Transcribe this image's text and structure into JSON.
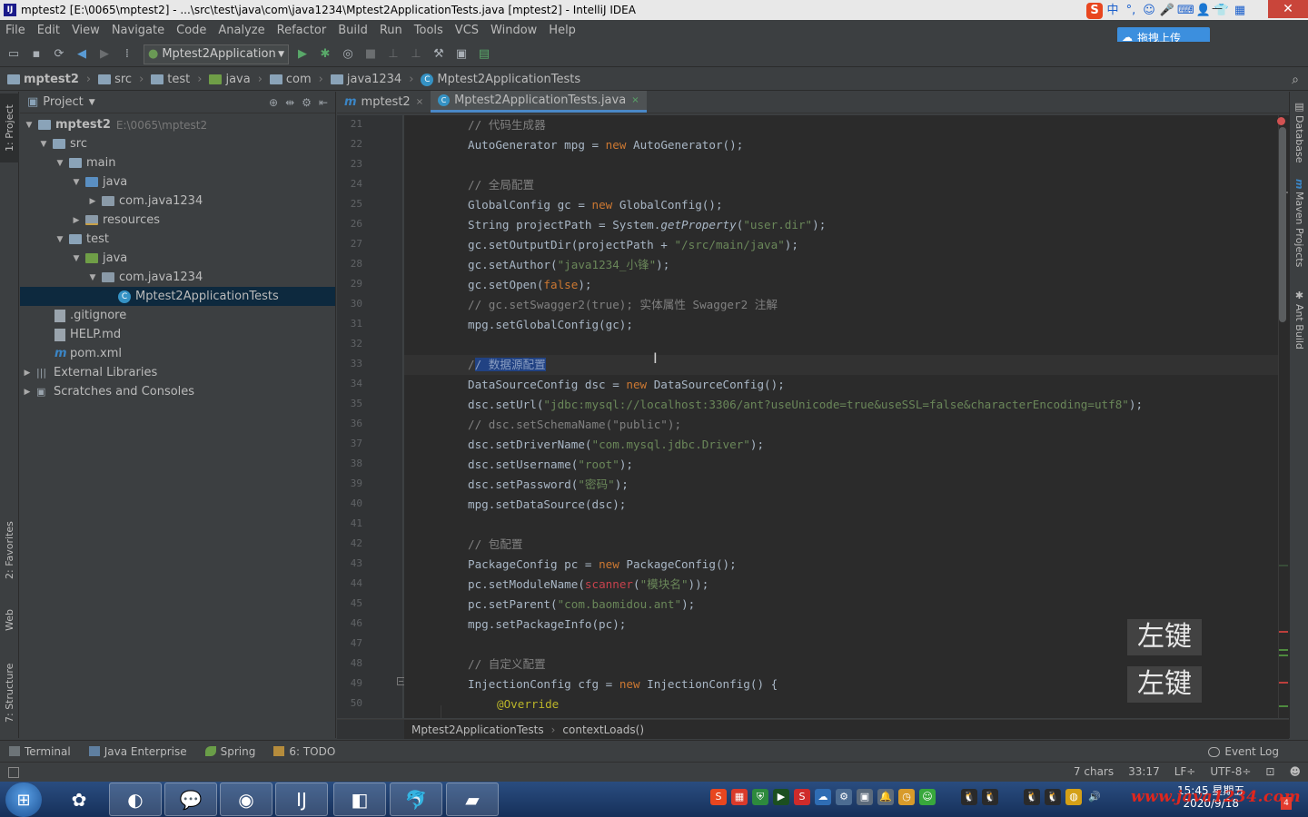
{
  "window": {
    "title": "mptest2 [E:\\0065\\mptest2] - ...\\src\\test\\java\\com\\java1234\\Mptest2ApplicationTests.java [mptest2] - IntelliJ IDEA",
    "app_icon_label": "IJ",
    "minimize": "—",
    "close": "✕"
  },
  "ime": {
    "sogou": "S",
    "items": [
      "中",
      "°,",
      "☺",
      "🎤",
      "⌨",
      "👤",
      "👕",
      "▦"
    ]
  },
  "upload_label": "拖拽上传",
  "menu": [
    "File",
    "Edit",
    "View",
    "Navigate",
    "Code",
    "Analyze",
    "Refactor",
    "Build",
    "Run",
    "Tools",
    "VCS",
    "Window",
    "Help"
  ],
  "toolbar": {
    "run_config": "Mptest2Application"
  },
  "breadcrumbs": [
    "mptest2",
    "src",
    "test",
    "java",
    "com",
    "java1234",
    "Mptest2ApplicationTests"
  ],
  "left_stripe": {
    "project": "1: Project",
    "favorites": "2: Favorites",
    "web": "Web",
    "structure": "7: Structure"
  },
  "project_panel": {
    "title": "Project",
    "tree": [
      {
        "label": "mptest2",
        "path": "E:\\0065\\mptest2"
      },
      {
        "label": "src"
      },
      {
        "label": "main"
      },
      {
        "label": "java"
      },
      {
        "label": "com.java1234"
      },
      {
        "label": "resources"
      },
      {
        "label": "test"
      },
      {
        "label": "java"
      },
      {
        "label": "com.java1234"
      },
      {
        "label": "Mptest2ApplicationTests"
      },
      {
        "label": ".gitignore"
      },
      {
        "label": "HELP.md"
      },
      {
        "label": "pom.xml"
      },
      {
        "label": "External Libraries"
      },
      {
        "label": "Scratches and Consoles"
      }
    ]
  },
  "tabs": [
    {
      "label": "mptest2",
      "close": "×"
    },
    {
      "label": "Mptest2ApplicationTests.java",
      "close": "×"
    }
  ],
  "editor": {
    "first_line": 21,
    "line_numbers": [
      "21",
      "22",
      "23",
      "24",
      "25",
      "26",
      "27",
      "28",
      "29",
      "30",
      "31",
      "32",
      "33",
      "34",
      "35",
      "36",
      "37",
      "38",
      "39",
      "40",
      "41",
      "42",
      "43",
      "44",
      "45",
      "46",
      "47",
      "48",
      "49",
      "50"
    ],
    "lines": [
      "// 代码生成器",
      "AutoGenerator mpg = new AutoGenerator();",
      "",
      "// 全局配置",
      "GlobalConfig gc = new GlobalConfig();",
      "String projectPath = System.getProperty(\"user.dir\");",
      "gc.setOutputDir(projectPath + \"/src/main/java\");",
      "gc.setAuthor(\"java1234_小锋\");",
      "gc.setOpen(false);",
      "// gc.setSwagger2(true); 实体属性 Swagger2 注解",
      "mpg.setGlobalConfig(gc);",
      "",
      "// 数据源配置",
      "DataSourceConfig dsc = new DataSourceConfig();",
      "dsc.setUrl(\"jdbc:mysql://localhost:3306/ant?useUnicode=true&useSSL=false&characterEncoding=utf8\");",
      "// dsc.setSchemaName(\"public\");",
      "dsc.setDriverName(\"com.mysql.jdbc.Driver\");",
      "dsc.setUsername(\"root\");",
      "dsc.setPassword(\"密码\");",
      "mpg.setDataSource(dsc);",
      "",
      "// 包配置",
      "PackageConfig pc = new PackageConfig();",
      "pc.setModuleName(scanner(\"模块名\"));",
      "pc.setParent(\"com.baomidou.ant\");",
      "mpg.setPackageInfo(pc);",
      "",
      "// 自定义配置",
      "InjectionConfig cfg = new InjectionConfig() {",
      "@Override"
    ],
    "current_line": 33
  },
  "editor_breadcrumb": [
    "Mptest2ApplicationTests",
    "contextLoads()"
  ],
  "right_stripe": {
    "database": "Database",
    "maven": "Maven Projects",
    "ant": "Ant Build"
  },
  "key_hints": [
    "左键",
    "左键"
  ],
  "tool_windows": [
    "Terminal",
    "Java Enterprise",
    "Spring",
    "6: TODO"
  ],
  "event_log": "Event Log",
  "status": {
    "chars": "7 chars",
    "position": "33:17",
    "line_sep": "LF÷",
    "encoding": "UTF-8÷"
  },
  "taskbar": {
    "time": "15:45 星期五",
    "date": "2020/9/18",
    "watermark": "www.java1234.com",
    "notif_count": "4"
  }
}
